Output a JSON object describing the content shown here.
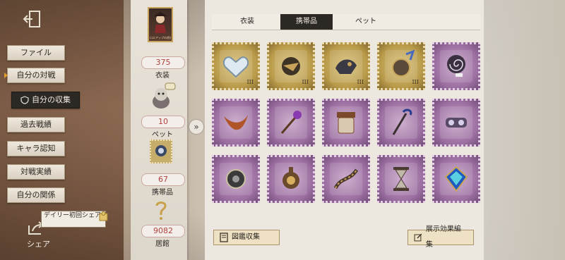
{
  "nav": {
    "items": [
      "ファイル",
      "自分の対戦",
      "自分の収集",
      "過去戦績",
      "キャラ認知",
      "対戦実績",
      "自分の関係"
    ],
    "active_index": 2
  },
  "share": {
    "daily_text": "デイリー初回シェア",
    "label": "シェア"
  },
  "stats": [
    {
      "value": "375",
      "label": "衣装"
    },
    {
      "value": "10",
      "label": "ペット"
    },
    {
      "value": "67",
      "label": "携帯品"
    },
    {
      "value": "9082",
      "label": "居館"
    }
  ],
  "portrait_caption": "ロエアップの遊芸",
  "tabs": [
    {
      "label": "衣装",
      "active": false
    },
    {
      "label": "携帯品",
      "active": true
    },
    {
      "label": "ペット",
      "active": false
    }
  ],
  "items": [
    {
      "frame": "gold",
      "icon": "heart-crystal-icon",
      "lvl": "III"
    },
    {
      "frame": "gold",
      "icon": "bird-ornament-icon",
      "lvl": "III"
    },
    {
      "frame": "gold",
      "icon": "mechanical-bird-icon",
      "lvl": "III"
    },
    {
      "frame": "gold",
      "icon": "winged-compass-icon",
      "lvl": "III"
    },
    {
      "frame": "purple",
      "icon": "spiral-lollipop-icon",
      "lvl": ""
    },
    {
      "frame": "purple",
      "icon": "boomerang-icon",
      "lvl": ""
    },
    {
      "frame": "purple",
      "icon": "scepter-icon",
      "lvl": ""
    },
    {
      "frame": "purple",
      "icon": "jar-icon",
      "lvl": ""
    },
    {
      "frame": "purple",
      "icon": "umbrella-cane-icon",
      "lvl": ""
    },
    {
      "frame": "purple",
      "icon": "gadget-icon",
      "lvl": ""
    },
    {
      "frame": "purple",
      "icon": "pocket-watch-icon",
      "lvl": ""
    },
    {
      "frame": "purple",
      "icon": "lantern-icon",
      "lvl": ""
    },
    {
      "frame": "purple",
      "icon": "chain-icon",
      "lvl": ""
    },
    {
      "frame": "purple",
      "icon": "hourglass-icon",
      "lvl": ""
    },
    {
      "frame": "purple",
      "icon": "blue-gem-icon",
      "lvl": ""
    }
  ],
  "buttons": {
    "catalog": "図鑑収集",
    "edit": "展示効果編集"
  }
}
